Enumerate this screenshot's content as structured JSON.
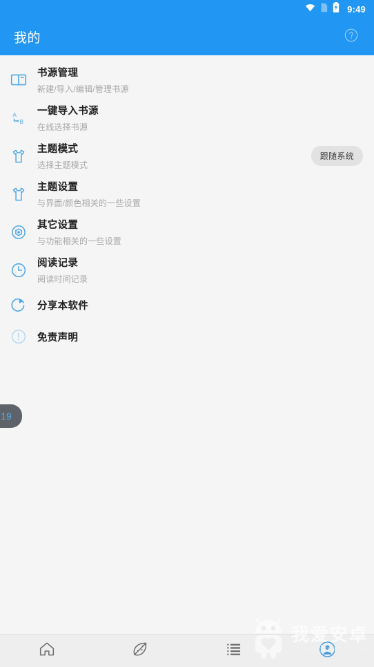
{
  "status_bar": {
    "time": "9:49",
    "icons": [
      "wifi-icon",
      "sim-card-icon",
      "battery-charging-icon"
    ]
  },
  "app_bar": {
    "title": "我的",
    "help_icon": "help-circle-icon"
  },
  "colors": {
    "primary": "#2196f3",
    "background": "#f5f5f5",
    "title_text": "#212121",
    "sub_text": "#a8a8a8",
    "badge_bg": "#e2e2e2",
    "nav_bg": "#eeeeee",
    "active_nav": "#2196f3"
  },
  "list": {
    "items": [
      {
        "icon": "open-book-icon",
        "title": "书源管理",
        "subtitle": "新建/导入/编辑/管理书源",
        "badge": ""
      },
      {
        "icon": "a-to-b-import-icon",
        "title": "一键导入书源",
        "subtitle": "在线选择书源",
        "badge": ""
      },
      {
        "icon": "tshirt-icon",
        "title": "主题模式",
        "subtitle": "选择主题模式",
        "badge": "跟随系统"
      },
      {
        "icon": "tshirt-icon",
        "title": "主题设置",
        "subtitle": "与界面/颜色相关的一些设置",
        "badge": ""
      },
      {
        "icon": "gear-hexagon-icon",
        "title": "其它设置",
        "subtitle": "与功能相关的一些设置",
        "badge": ""
      },
      {
        "icon": "clock-icon",
        "title": "阅读记录",
        "subtitle": "阅读时间记录",
        "badge": ""
      },
      {
        "icon": "share-refresh-icon",
        "title": "分享本软件",
        "subtitle": "",
        "badge": ""
      },
      {
        "icon": "exclamation-circle-icon",
        "title": "免责声明",
        "subtitle": "",
        "badge": ""
      }
    ]
  },
  "counter_bubble": {
    "value": "19"
  },
  "bottom_nav": {
    "items": [
      {
        "icon": "home-icon",
        "active": false
      },
      {
        "icon": "leaf-discover-icon",
        "active": false
      },
      {
        "icon": "list-icon",
        "active": false
      },
      {
        "icon": "profile-icon",
        "active": true
      }
    ]
  },
  "watermark": {
    "logo": "android-robot-icon",
    "title": "我爱安卓",
    "subtitle": "52android.com"
  }
}
